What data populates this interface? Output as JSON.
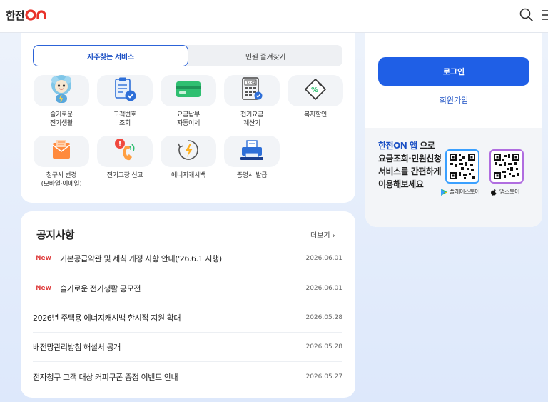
{
  "header": {
    "logo_text": "한전",
    "logo_on": "ON",
    "search_icon": "search-icon",
    "menu_icon": "menu-icon"
  },
  "services": {
    "tabs": [
      {
        "label": "자주찾는 서비스",
        "active": true
      },
      {
        "label": "민원 즐겨찾기",
        "active": false
      }
    ],
    "items": [
      {
        "label": "슬기로운\n전기생활",
        "icon": "mascot-icon"
      },
      {
        "label": "고객번호\n조회",
        "icon": "clipboard-check-icon"
      },
      {
        "label": "요금납부\n자동이체",
        "icon": "card-icon"
      },
      {
        "label": "전기요금\n계산기",
        "icon": "calculator-icon"
      },
      {
        "label": "복지할인",
        "icon": "discount-tag-icon"
      },
      {
        "label": "청구서 변경\n(모바일·이메일)",
        "icon": "envelope-icon"
      },
      {
        "label": "전기고장 신고",
        "icon": "phone-alert-icon"
      },
      {
        "label": "에너지캐시백",
        "icon": "energy-cashback-icon"
      },
      {
        "label": "증명서 발급",
        "icon": "printer-icon"
      }
    ]
  },
  "notices": {
    "title": "공지사항",
    "more_label": "더보기 ›",
    "items": [
      {
        "new": "New",
        "text": "기본공급약관 및 세칙 개정 사항 안내('26.6.1 시행)",
        "date": "2026.06.01"
      },
      {
        "new": "New",
        "text": "슬기로운 전기생활 공모전",
        "date": "2026.06.01"
      },
      {
        "new": "",
        "text": "2026년 주택용 에너지캐시백 한시적 지원 확대",
        "date": "2026.05.28"
      },
      {
        "new": "",
        "text": "배전망관리방침 해설서 공개",
        "date": "2026.05.28"
      },
      {
        "new": "",
        "text": "전자청구 고객 대상 커피쿠폰 증정 이벤트 안내",
        "date": "2026.05.27"
      }
    ]
  },
  "login": {
    "login_label": "로그인",
    "signup_label": "회원가입"
  },
  "app_promo": {
    "highlight": "한전ON 앱",
    "text": " 으로 요금조회·민원신청 서비스를 간편하게 이용해보세요",
    "play_store_label": "플레이스토어",
    "app_store_label": "앱스토어"
  },
  "colors": {
    "accent": "#1f5fe6",
    "link": "#1a4fc4",
    "new_badge": "#e04545",
    "brand_red": "#e8322a"
  }
}
